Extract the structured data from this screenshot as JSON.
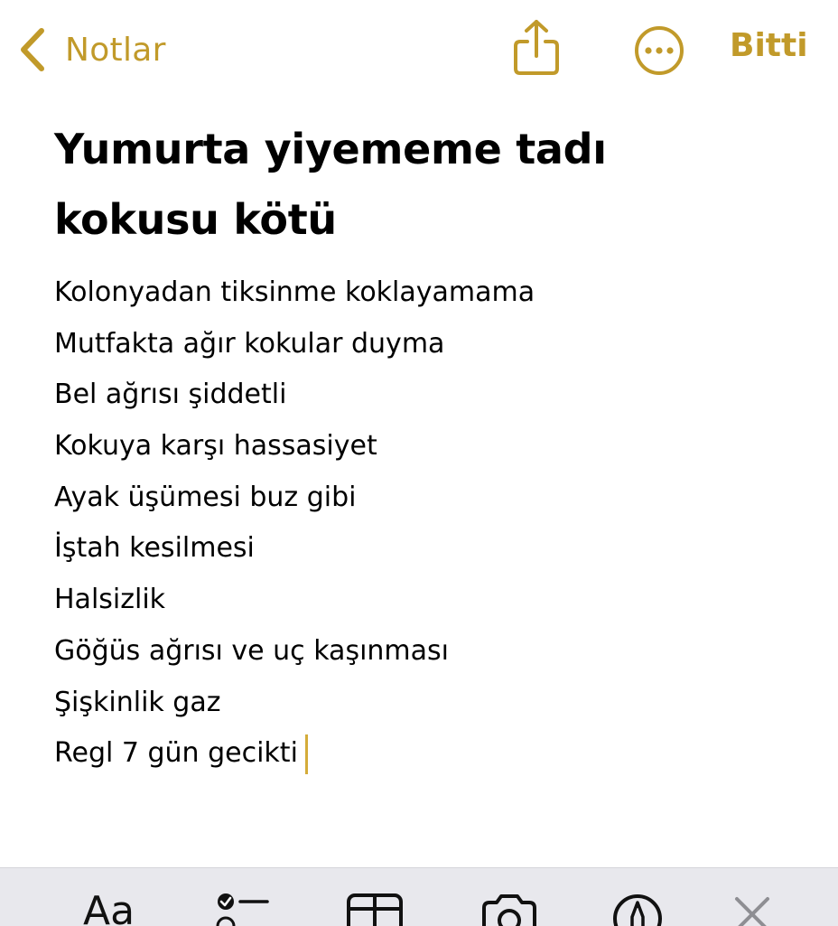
{
  "navbar": {
    "back_label": "Notlar",
    "back_icon": "chevron-left-icon",
    "share_icon": "share-icon",
    "more_icon": "ellipsis-circle-icon",
    "done_label": "Bitti",
    "accent_color": "#c19a2a"
  },
  "note": {
    "title": "Yumurta yiyememe tadı kokusu kötü",
    "lines": [
      "Kolonyadan tiksinme koklayamama",
      "Mutfakta ağır kokular duyma",
      "Bel ağrısı şiddetli",
      "Kokuya karşı hassasiyet",
      "Ayak üşümesi buz gibi",
      "İştah kesilmesi",
      "Halsizlik",
      "Göğüs ağrısı ve uç kaşınması",
      "Şişkinlik gaz",
      "Regl 7 gün gecikti"
    ]
  },
  "toolbar": {
    "format_label": "Aa",
    "checklist_icon": "checklist-icon",
    "table_icon": "table-icon",
    "camera_icon": "camera-icon",
    "markup_icon": "pen-circle-icon",
    "close_icon": "close-icon",
    "background_color": "#e8e8ed"
  }
}
